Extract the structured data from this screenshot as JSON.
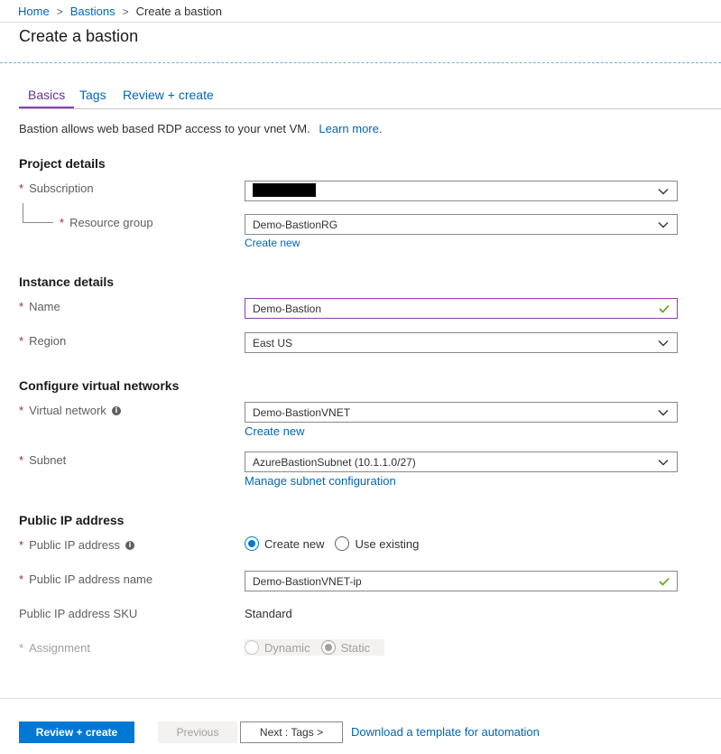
{
  "breadcrumb": {
    "home": "Home",
    "bastions": "Bastions",
    "current": "Create a bastion",
    "separator": ">"
  },
  "page_title": "Create a bastion",
  "tabs": [
    {
      "label": "Basics",
      "active": true
    },
    {
      "label": "Tags",
      "active": false
    },
    {
      "label": "Review + create",
      "active": false
    }
  ],
  "intro": {
    "text": "Bastion allows web based RDP access to your vnet VM.",
    "learn_more": "Learn more."
  },
  "project_details": {
    "heading": "Project details",
    "subscription": {
      "label": "Subscription",
      "value": ""
    },
    "resource_group": {
      "label": "Resource group",
      "value": "Demo-BastionRG",
      "create_new": "Create new"
    }
  },
  "instance_details": {
    "heading": "Instance details",
    "name": {
      "label": "Name",
      "value": "Demo-Bastion"
    },
    "region": {
      "label": "Region",
      "value": "East US"
    }
  },
  "virtual_networks": {
    "heading": "Configure virtual networks",
    "vnet": {
      "label": "Virtual network",
      "value": "Demo-BastionVNET",
      "create_new": "Create new"
    },
    "subnet": {
      "label": "Subnet",
      "value": "AzureBastionSubnet (10.1.1.0/27)",
      "manage": "Manage subnet configuration"
    }
  },
  "public_ip": {
    "heading": "Public IP address",
    "address": {
      "label": "Public IP address",
      "options": [
        "Create new",
        "Use existing"
      ],
      "selected": "Create new"
    },
    "name": {
      "label": "Public IP address name",
      "value": "Demo-BastionVNET-ip"
    },
    "sku": {
      "label": "Public IP address SKU",
      "value": "Standard"
    },
    "assignment": {
      "label": "Assignment",
      "options": [
        "Dynamic",
        "Static"
      ],
      "selected": "Static"
    }
  },
  "required_marker": "*",
  "info_glyph": "i",
  "footer": {
    "review_create": "Review + create",
    "previous": "Previous",
    "next": "Next : Tags >",
    "download": "Download a template for automation"
  },
  "colors": {
    "accent": "#0078d4",
    "link": "#0066b8",
    "active_tab": "#8a3fb1",
    "required": "#a4262c",
    "valid_check": "#57a300"
  }
}
